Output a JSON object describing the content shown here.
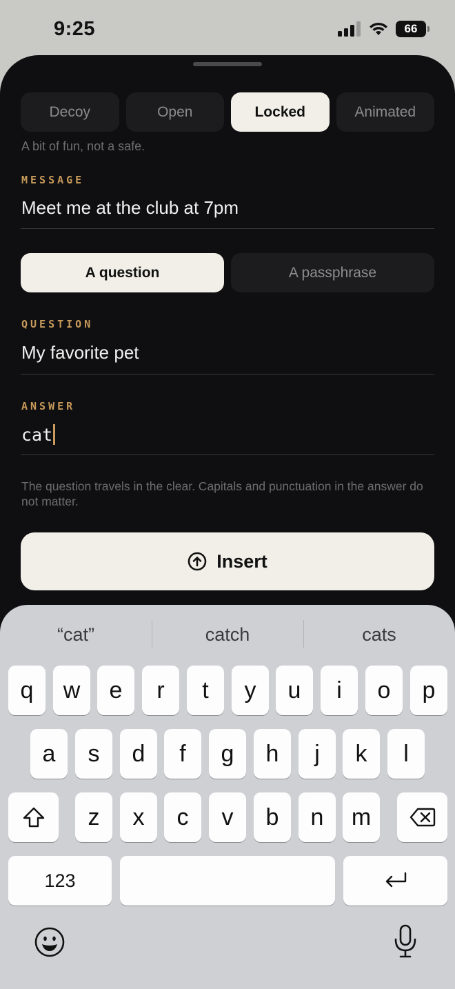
{
  "status": {
    "time": "9:25",
    "battery": "66"
  },
  "modes": [
    {
      "label": "Decoy",
      "active": false
    },
    {
      "label": "Open",
      "active": false
    },
    {
      "label": "Locked",
      "active": true
    },
    {
      "label": "Animated",
      "active": false
    }
  ],
  "mode_hint": "A bit of fun, not a safe.",
  "message": {
    "label": "MESSAGE",
    "value": "Meet me at the club at 7pm"
  },
  "lock_types": [
    {
      "label": "A question",
      "active": true
    },
    {
      "label": "A passphrase",
      "active": false
    }
  ],
  "question": {
    "label": "QUESTION",
    "value": "My favorite pet"
  },
  "answer": {
    "label": "ANSWER",
    "value": "cat"
  },
  "help": "The question travels in the clear. Capitals and punctuation in the answer do not matter.",
  "insert_label": "Insert",
  "keyboard": {
    "suggestions": [
      "“cat”",
      "catch",
      "cats"
    ],
    "row1": [
      "q",
      "w",
      "e",
      "r",
      "t",
      "y",
      "u",
      "i",
      "o",
      "p"
    ],
    "row2": [
      "a",
      "s",
      "d",
      "f",
      "g",
      "h",
      "j",
      "k",
      "l"
    ],
    "row3": [
      "z",
      "x",
      "c",
      "v",
      "b",
      "n",
      "m"
    ],
    "numbers_label": "123"
  },
  "colors": {
    "accent": "#c89b5a",
    "sheet": "#0f0f11",
    "active_seg": "#f1efe7",
    "keyboard": "#cfd0d4"
  }
}
